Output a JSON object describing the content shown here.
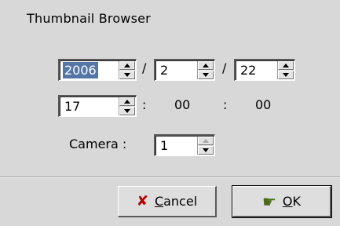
{
  "dialog": {
    "title": "Thumbnail Browser"
  },
  "date": {
    "year": "2006",
    "month": "2",
    "day": "22",
    "separator": "/"
  },
  "time": {
    "hour": "17",
    "minute": "00",
    "second": "00",
    "separator": ":"
  },
  "camera": {
    "label": "Camera :",
    "value": "1"
  },
  "buttons": {
    "cancel": {
      "mnemonic": "C",
      "rest": "ancel"
    },
    "ok": {
      "mnemonic": "O",
      "rest": "K"
    }
  },
  "icons": {
    "cancel": "cross-icon",
    "ok": "hand-pointer-icon"
  }
}
